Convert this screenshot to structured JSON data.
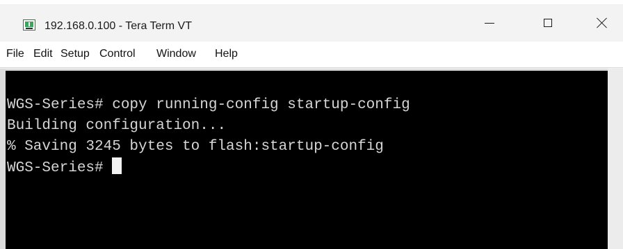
{
  "window": {
    "title": "192.168.0.100 - Tera Term VT"
  },
  "titlebar": {
    "icon": "tera-term-app-icon",
    "buttons": {
      "minimize_icon": "minimize-icon",
      "maximize_icon": "maximize-icon",
      "close_icon": "close-icon"
    }
  },
  "menu": {
    "items": [
      "File",
      "Edit",
      "Setup",
      "Control",
      "Window",
      "Help"
    ]
  },
  "terminal": {
    "prompt": "WGS-Series# ",
    "lines": [
      "WGS-Series# copy running-config startup-config",
      "Building configuration...",
      "% Saving 3245 bytes to flash:startup-config"
    ],
    "current_prompt": "WGS-Series# ",
    "colors": {
      "background": "#000000",
      "text": "#d6d6d6",
      "cursor": "#f2f2f2"
    }
  }
}
